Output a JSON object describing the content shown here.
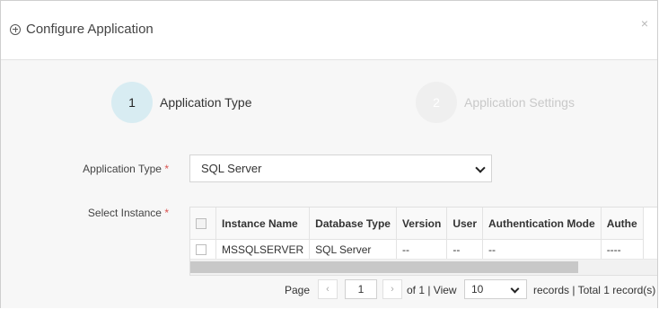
{
  "header": {
    "title": "Configure Application",
    "close_symbol": "×"
  },
  "steps": [
    {
      "number": "1",
      "label": "Application Type",
      "state": "active"
    },
    {
      "number": "2",
      "label": "Application Settings",
      "state": "inactive"
    }
  ],
  "form": {
    "app_type_label": "Application Type",
    "required_mark": "*",
    "app_type_value": "SQL Server",
    "instance_label": "Select Instance"
  },
  "table": {
    "columns": [
      "Instance Name",
      "Database Type",
      "Version",
      "User",
      "Authentication Mode",
      "Authe"
    ],
    "rows": [
      {
        "instance": "MSSQLSERVER",
        "db_type": "SQL Server",
        "version": "--",
        "user": "--",
        "auth_mode": "--",
        "auth": "----"
      }
    ]
  },
  "pager": {
    "page_label": "Page",
    "prev": "‹",
    "page_value": "1",
    "next": "›",
    "of_text": "of 1 | View",
    "view_value": "10",
    "records_text": "records | Total 1 record(s)"
  },
  "colors": {
    "step_active_bg": "#d8ecf2",
    "step_inactive_bg": "#efefef",
    "required": "#d9534f",
    "body_bg": "#f7f7f7"
  }
}
